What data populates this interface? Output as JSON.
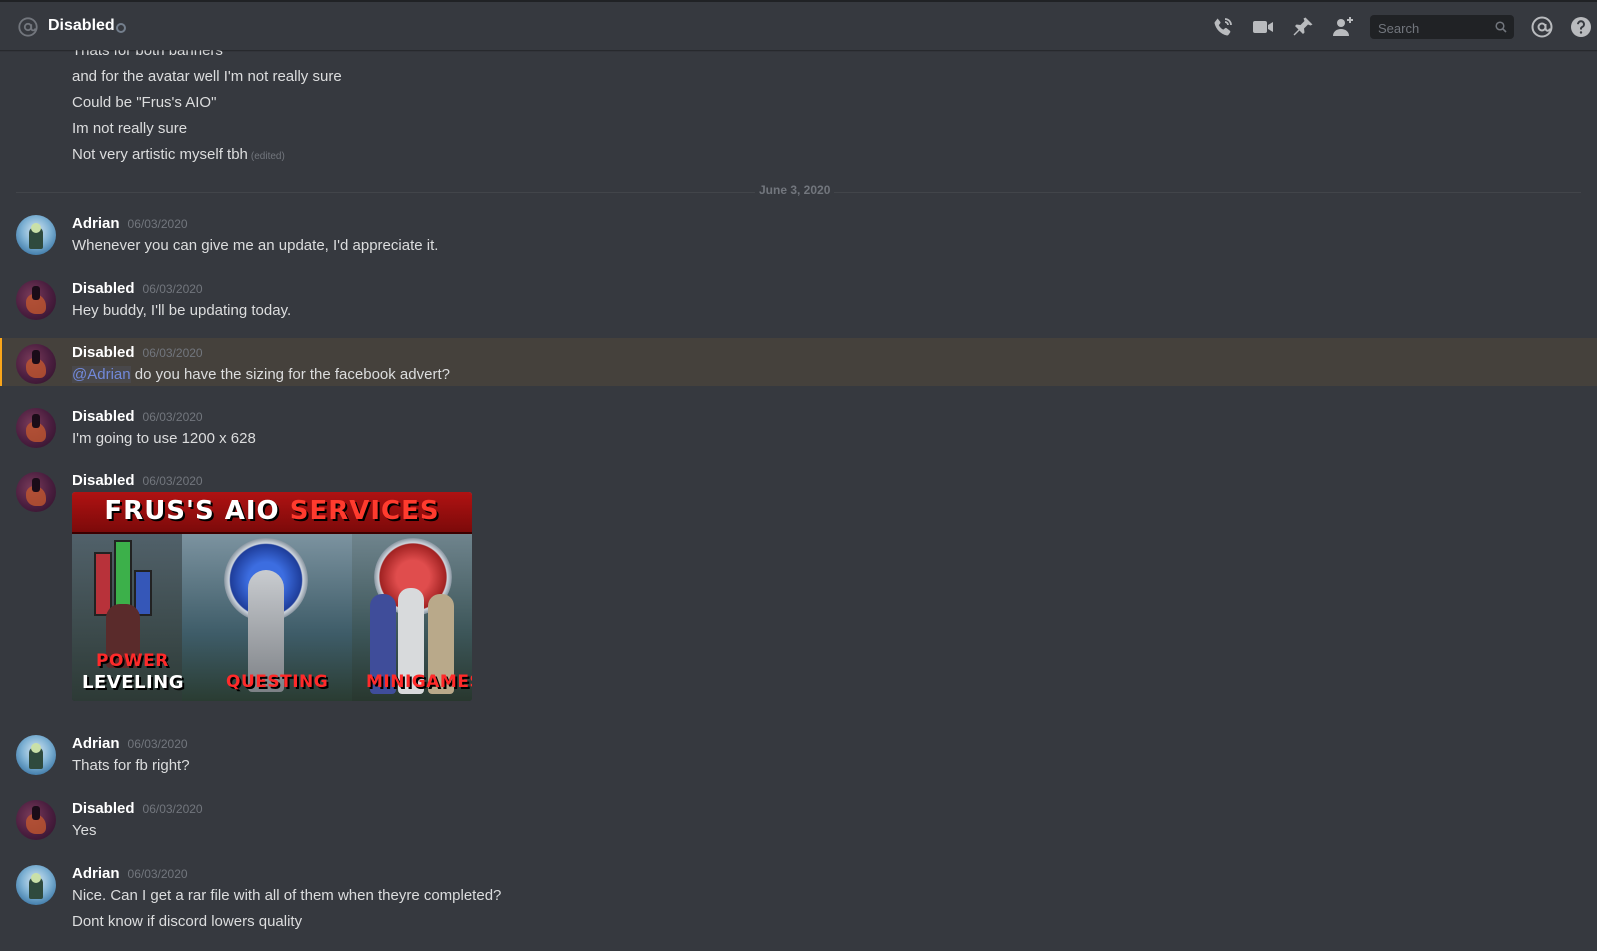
{
  "header": {
    "channel_name": "Disabled",
    "search_placeholder": "Search",
    "icons": [
      "at-icon",
      "status-icon",
      "call-icon",
      "video-icon",
      "pin-icon",
      "add-member-icon",
      "search-icon",
      "mention-icon",
      "help-icon"
    ]
  },
  "colors": {
    "background": "#36393f",
    "mention_highlight": "#faa61a",
    "mention_text": "#7289da",
    "timestamp": "#72767d"
  },
  "continuation_lines": [
    "Thats for both banners",
    "and for the avatar well I'm not really sure",
    "Could be \"Frus's AIO\"",
    "Im not really sure",
    "Not very artistic myself tbh"
  ],
  "edited_label": "(edited)",
  "date_divider": "June 3, 2020",
  "messages": [
    {
      "author": "Adrian",
      "timestamp": "06/03/2020",
      "text": "Whenever you can give me an update, I'd appreciate it."
    },
    {
      "author": "Disabled",
      "timestamp": "06/03/2020",
      "text": "Hey buddy, I'll be updating today."
    },
    {
      "author": "Disabled",
      "timestamp": "06/03/2020",
      "mention": "@Adrian",
      "text": " do you have the sizing for the facebook advert?"
    },
    {
      "author": "Disabled",
      "timestamp": "06/03/2020",
      "text": "I'm going to use 1200 x 628"
    },
    {
      "author": "Disabled",
      "timestamp": "06/03/2020"
    },
    {
      "author": "Adrian",
      "timestamp": "06/03/2020",
      "text": "Thats for fb right?"
    },
    {
      "author": "Disabled",
      "timestamp": "06/03/2020",
      "text": "Yes"
    },
    {
      "author": "Adrian",
      "timestamp": "06/03/2020",
      "text": "Nice. Can I get a rar file with all of them when theyre completed?",
      "text2": "Dont know if discord lowers quality"
    }
  ],
  "attachment": {
    "title_white": "FRUS'S AIO ",
    "title_red": "SERVICES",
    "panel1_top": "POWER",
    "panel1_bottom": "LEVELING",
    "panel2": "QUESTING",
    "panel3": "MINIGAMES"
  }
}
